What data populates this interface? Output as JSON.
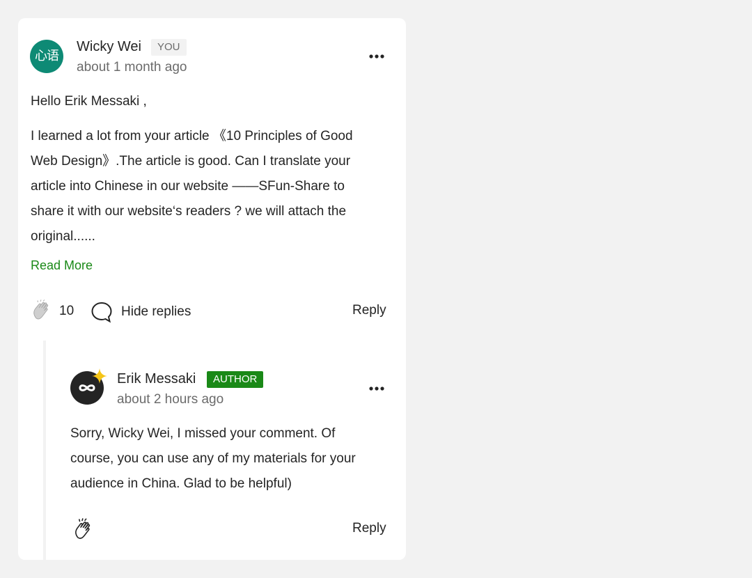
{
  "comment": {
    "avatar_text": "心语",
    "author": "Wicky Wei",
    "badge": "YOU",
    "time": "about 1 month ago",
    "greeting": "Hello Erik Messaki ,",
    "body_lines": [
      "I learned a lot from your article 《10 Principles of Good",
      "Web Design》.The article is good. Can I translate your",
      "article into Chinese in our website ——SFun-Share to",
      "share it with our website‘s readers ? we will attach the",
      "original......"
    ],
    "read_more": "Read More",
    "clap_count": "10",
    "hide_replies": "Hide replies",
    "reply_label": "Reply"
  },
  "reply": {
    "author": "Erik Messaki",
    "badge": "AUTHOR",
    "time": "about 2 hours ago",
    "body_lines": [
      "Sorry, Wicky Wei, I missed your comment. Of",
      "course, you can use any of my materials for your",
      "audience in China. Glad to be helpful)"
    ],
    "reply_label": "Reply"
  },
  "colors": {
    "accent_green": "#1a8917",
    "avatar_teal": "#0e8a75",
    "text": "#242424",
    "muted": "#6b6b6b",
    "page_bg": "#f2f2f2",
    "star_yellow": "#f5c518"
  },
  "icons": {
    "more": "more-horizontal-icon",
    "clap": "clap-icon",
    "comment": "comment-bubble-icon",
    "star": "star-badge-icon"
  }
}
